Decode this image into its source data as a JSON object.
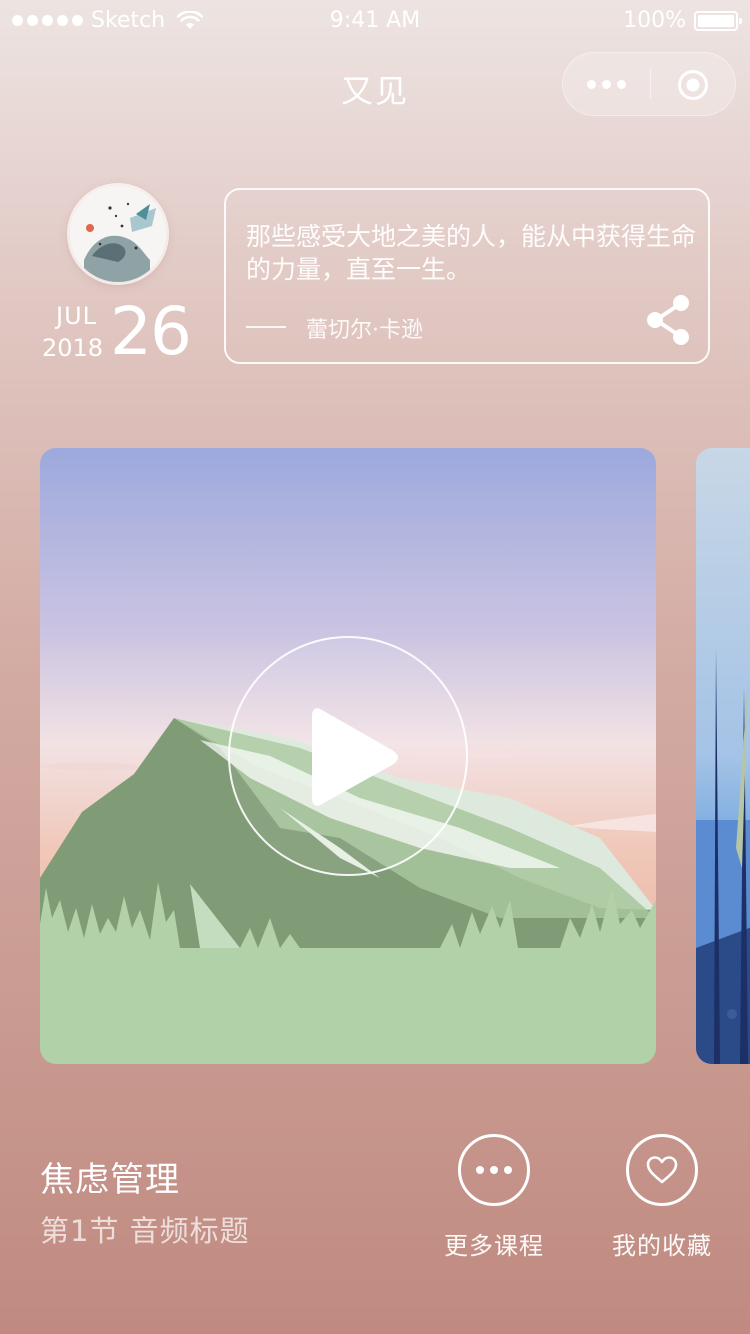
{
  "status_bar": {
    "carrier": "Sketch",
    "time": "9:41 AM",
    "battery": "100%"
  },
  "nav": {
    "title": "又见",
    "more_icon": "more-dots-icon",
    "close_icon": "target-circle-icon"
  },
  "date": {
    "month": "JUL",
    "year": "2018",
    "day": "26"
  },
  "quote": {
    "text": "那些感受大地之美的人，能从中获得生命的力量，直至一生。",
    "author": "蕾切尔·卡逊",
    "share_icon": "share-icon"
  },
  "player": {
    "play_icon": "play-icon"
  },
  "course": {
    "title": "焦虑管理",
    "subtitle": "第1节 音频标题"
  },
  "actions": {
    "more_label": "更多课程",
    "favorite_label": "我的收藏"
  }
}
